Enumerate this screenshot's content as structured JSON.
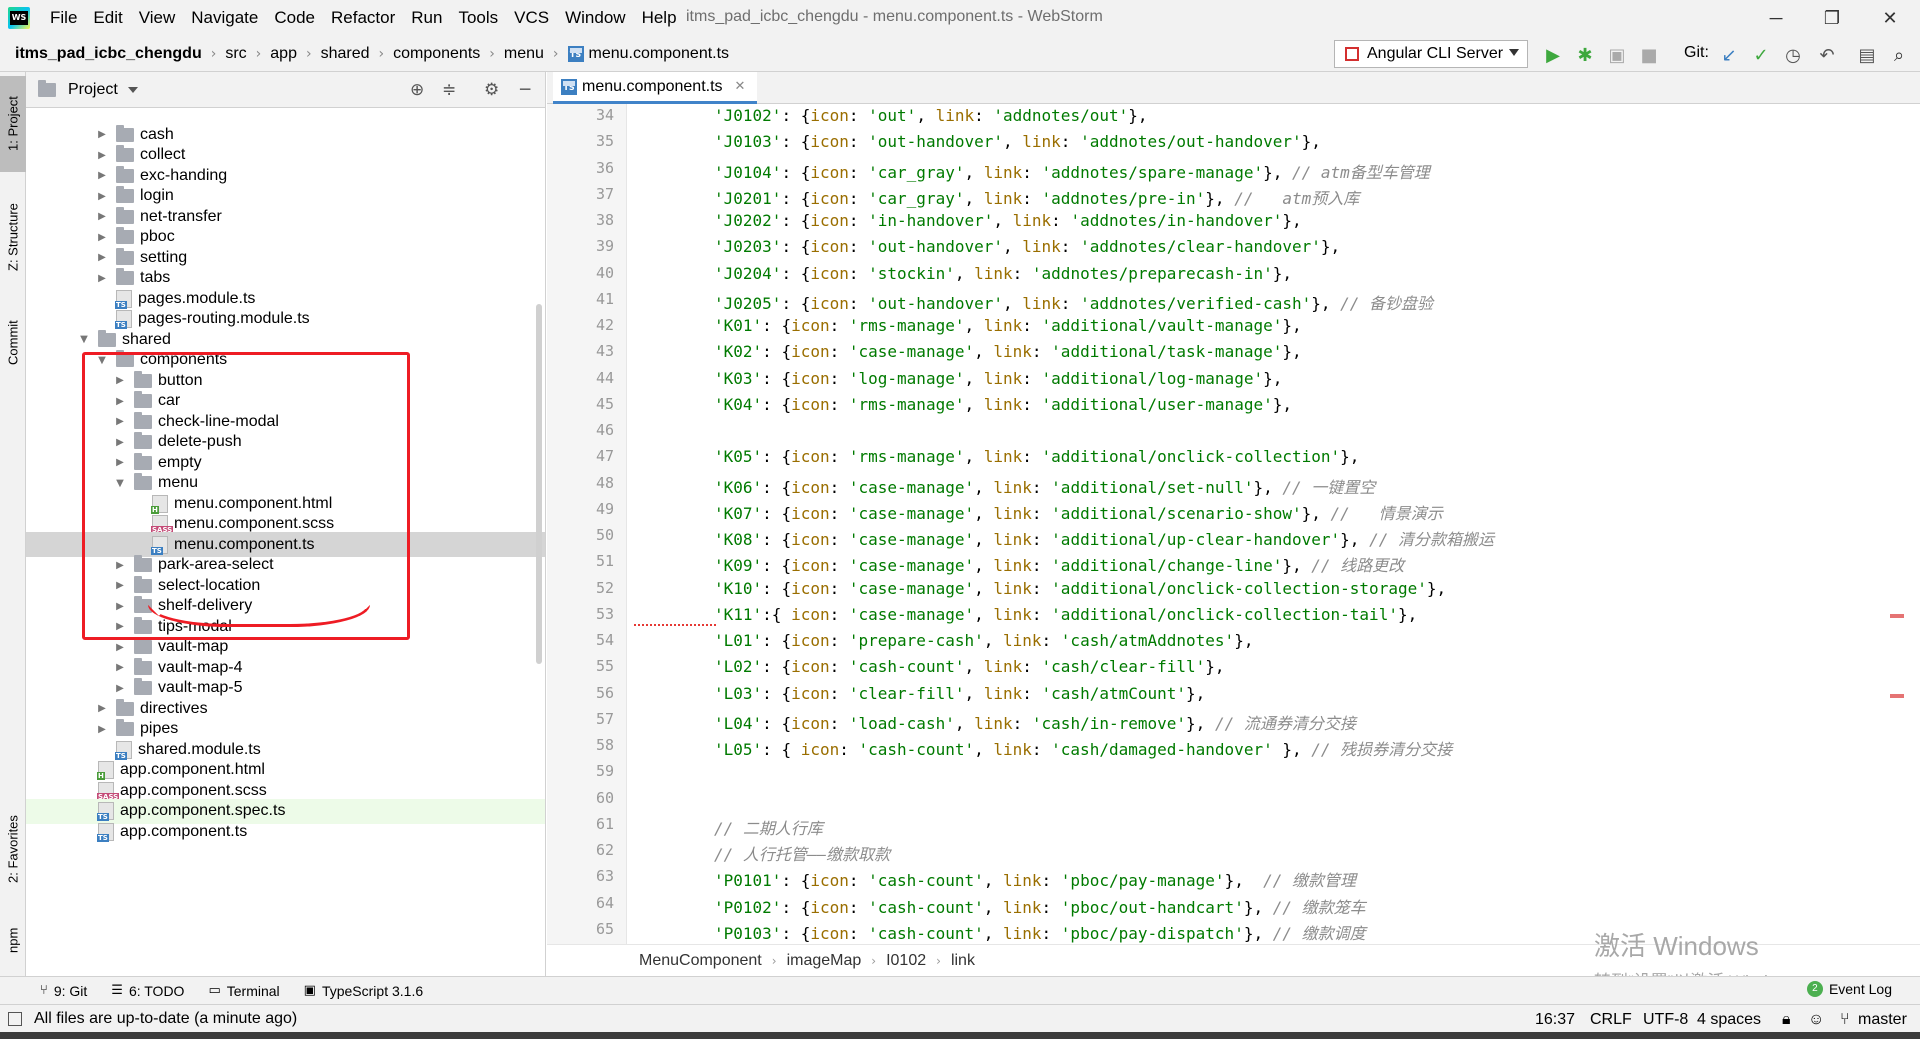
{
  "menubar": {
    "items": [
      "File",
      "Edit",
      "View",
      "Navigate",
      "Code",
      "Refactor",
      "Run",
      "Tools",
      "VCS",
      "Window",
      "Help"
    ],
    "window_title": "itms_pad_icbc_chengdu - menu.component.ts - WebStorm"
  },
  "navbar": {
    "crumbs": [
      "itms_pad_icbc_chengdu",
      "src",
      "app",
      "shared",
      "components",
      "menu"
    ],
    "file": "menu.component.ts",
    "run_config": "Angular CLI Server",
    "git_label": "Git:"
  },
  "left_stripe": {
    "project": "1: Project",
    "structure": "Z: Structure",
    "commit": "Commit",
    "favorites": "2: Favorites",
    "npm": "npm"
  },
  "project_panel": {
    "title": "Project",
    "tree": [
      {
        "label": "cash",
        "type": "folder",
        "depth": 2,
        "expanded": false
      },
      {
        "label": "collect",
        "type": "folder",
        "depth": 2,
        "expanded": false
      },
      {
        "label": "exc-handing",
        "type": "folder",
        "depth": 2,
        "expanded": false
      },
      {
        "label": "login",
        "type": "folder",
        "depth": 2,
        "expanded": false
      },
      {
        "label": "net-transfer",
        "type": "folder",
        "depth": 2,
        "expanded": false
      },
      {
        "label": "pboc",
        "type": "folder",
        "depth": 2,
        "expanded": false
      },
      {
        "label": "setting",
        "type": "folder",
        "depth": 2,
        "expanded": false
      },
      {
        "label": "tabs",
        "type": "folder",
        "depth": 2,
        "expanded": false
      },
      {
        "label": "pages.module.ts",
        "type": "ts",
        "depth": 2
      },
      {
        "label": "pages-routing.module.ts",
        "type": "ts",
        "depth": 2
      },
      {
        "label": "shared",
        "type": "folder",
        "depth": 1,
        "expanded": true
      },
      {
        "label": "components",
        "type": "folder",
        "depth": 2,
        "expanded": true
      },
      {
        "label": "button",
        "type": "folder",
        "depth": 3,
        "expanded": false
      },
      {
        "label": "car",
        "type": "folder",
        "depth": 3,
        "expanded": false
      },
      {
        "label": "check-line-modal",
        "type": "folder",
        "depth": 3,
        "expanded": false
      },
      {
        "label": "delete-push",
        "type": "folder",
        "depth": 3,
        "expanded": false
      },
      {
        "label": "empty",
        "type": "folder",
        "depth": 3,
        "expanded": false
      },
      {
        "label": "menu",
        "type": "folder",
        "depth": 3,
        "expanded": true
      },
      {
        "label": "menu.component.html",
        "type": "html",
        "depth": 4
      },
      {
        "label": "menu.component.scss",
        "type": "sass",
        "depth": 4
      },
      {
        "label": "menu.component.ts",
        "type": "ts",
        "depth": 4,
        "selected": true
      },
      {
        "label": "park-area-select",
        "type": "folder",
        "depth": 3,
        "expanded": false
      },
      {
        "label": "select-location",
        "type": "folder",
        "depth": 3,
        "expanded": false
      },
      {
        "label": "shelf-delivery",
        "type": "folder",
        "depth": 3,
        "expanded": false
      },
      {
        "label": "tips-modal",
        "type": "folder",
        "depth": 3,
        "expanded": false
      },
      {
        "label": "vault-map",
        "type": "folder",
        "depth": 3,
        "expanded": false
      },
      {
        "label": "vault-map-4",
        "type": "folder",
        "depth": 3,
        "expanded": false
      },
      {
        "label": "vault-map-5",
        "type": "folder",
        "depth": 3,
        "expanded": false
      },
      {
        "label": "directives",
        "type": "folder",
        "depth": 2,
        "expanded": false
      },
      {
        "label": "pipes",
        "type": "folder",
        "depth": 2,
        "expanded": false
      },
      {
        "label": "shared.module.ts",
        "type": "ts",
        "depth": 2
      },
      {
        "label": "app.component.html",
        "type": "html",
        "depth": 1
      },
      {
        "label": "app.component.scss",
        "type": "sass",
        "depth": 1
      },
      {
        "label": "app.component.spec.ts",
        "type": "ts",
        "depth": 1,
        "spec": true
      },
      {
        "label": "app.component.ts",
        "type": "ts",
        "depth": 1
      }
    ]
  },
  "editor": {
    "tab_label": "menu.component.ts",
    "lines": [
      {
        "n": "34",
        "t": "'J0102': {icon: 'out', link: 'addnotes/out'},"
      },
      {
        "n": "35",
        "t": "'J0103': {icon: 'out-handover', link: 'addnotes/out-handover'},"
      },
      {
        "n": "36",
        "t": "'J0104': {icon: 'car_gray', link: 'addnotes/spare-manage'}, // atm备型车管理"
      },
      {
        "n": "37",
        "t": "'J0201': {icon: 'car_gray', link: 'addnotes/pre-in'}, //   atm预入库"
      },
      {
        "n": "38",
        "t": "'J0202': {icon: 'in-handover', link: 'addnotes/in-handover'},"
      },
      {
        "n": "39",
        "t": "'J0203': {icon: 'out-handover', link: 'addnotes/clear-handover'},"
      },
      {
        "n": "40",
        "t": "'J0204': {icon: 'stockin', link: 'addnotes/preparecash-in'},"
      },
      {
        "n": "41",
        "t": "'J0205': {icon: 'out-handover', link: 'addnotes/verified-cash'}, // 备钞盘验"
      },
      {
        "n": "42",
        "t": "'K01': {icon: 'rms-manage', link: 'additional/vault-manage'},"
      },
      {
        "n": "43",
        "t": "'K02': {icon: 'case-manage', link: 'additional/task-manage'},"
      },
      {
        "n": "44",
        "t": "'K03': {icon: 'log-manage', link: 'additional/log-manage'},"
      },
      {
        "n": "45",
        "t": "'K04': {icon: 'rms-manage', link: 'additional/user-manage'},"
      },
      {
        "n": "46",
        "t": ""
      },
      {
        "n": "47",
        "t": "'K05': {icon: 'rms-manage', link: 'additional/onclick-collection'},"
      },
      {
        "n": "48",
        "t": "'K06': {icon: 'case-manage', link: 'additional/set-null'}, // 一键置空"
      },
      {
        "n": "49",
        "t": "'K07': {icon: 'case-manage', link: 'additional/scenario-show'}, //   情景演示"
      },
      {
        "n": "50",
        "t": "'K08': {icon: 'case-manage', link: 'additional/up-clear-handover'}, // 清分款箱搬运"
      },
      {
        "n": "51",
        "t": "'K09': {icon: 'case-manage', link: 'additional/change-line'}, // 线路更改"
      },
      {
        "n": "52",
        "t": "'K10': {icon: 'case-manage', link: 'additional/onclick-collection-storage'},"
      },
      {
        "n": "53",
        "t": "'K11':{ icon: 'case-manage', link: 'additional/onclick-collection-tail'},"
      },
      {
        "n": "54",
        "t": "'L01': {icon: 'prepare-cash', link: 'cash/atmAddnotes'},"
      },
      {
        "n": "55",
        "t": "'L02': {icon: 'cash-count', link: 'cash/clear-fill'},"
      },
      {
        "n": "56",
        "t": "'L03': {icon: 'clear-fill', link: 'cash/atmCount'},"
      },
      {
        "n": "57",
        "t": "'L04': {icon: 'load-cash', link: 'cash/in-remove'}, // 流通券清分交接"
      },
      {
        "n": "58",
        "t": "'L05': { icon: 'cash-count', link: 'cash/damaged-handover' }, // 残损券清分交接"
      },
      {
        "n": "59",
        "t": ""
      },
      {
        "n": "60",
        "t": ""
      },
      {
        "n": "61",
        "t": "// 二期人行库"
      },
      {
        "n": "62",
        "t": "// 人行托管——缴款取款"
      },
      {
        "n": "63",
        "t": "'P0101': {icon: 'cash-count', link: 'pboc/pay-manage'},  // 缴款管理"
      },
      {
        "n": "64",
        "t": "'P0102': {icon: 'cash-count', link: 'pboc/out-handcart'}, // 缴款笼车"
      },
      {
        "n": "65",
        "t": "'P0103': {icon: 'cash-count', link: 'pboc/pay-dispatch'}, // 缴款调度"
      }
    ],
    "breadcrumb": [
      "MenuComponent",
      "imageMap",
      "I0102",
      "link"
    ]
  },
  "watermark": {
    "line1": "激活 Windows",
    "line2": "转到“设置”以激活 Windows。"
  },
  "bottom_tools": {
    "git": "9: Git",
    "todo": "6: TODO",
    "terminal": "Terminal",
    "typescript": "TypeScript 3.1.6",
    "event_log": "Event Log",
    "event_log_count": "2"
  },
  "statusbar": {
    "message": "All files are up-to-date (a minute ago)",
    "position": "16:37",
    "line_sep": "CRLF",
    "encoding": "UTF-8",
    "indent": "4 spaces",
    "branch": "master"
  },
  "colors": {
    "annotation": "#ee1c24",
    "selection": "#d5d5d5",
    "string": "#007a00",
    "comment": "#8c8c8c"
  }
}
